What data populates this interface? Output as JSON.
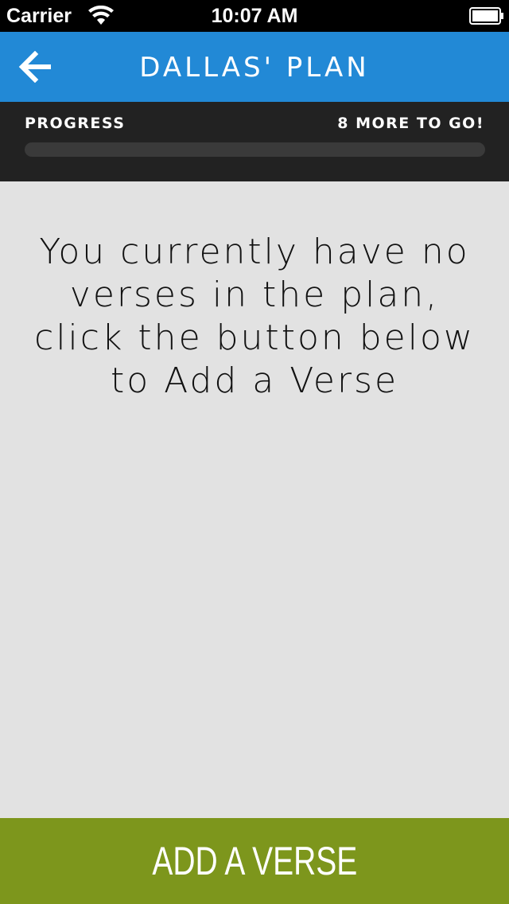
{
  "status_bar": {
    "carrier": "Carrier",
    "time": "10:07 AM",
    "wifi_icon": "wifi-icon",
    "battery_icon": "battery-icon"
  },
  "header": {
    "back_icon": "arrow-left-icon",
    "title": "DALLAS' PLAN"
  },
  "progress": {
    "label": "PROGRESS",
    "remaining_text": "8 MORE TO GO!",
    "fraction": 0
  },
  "main": {
    "empty_message": "You currently have no verses in the plan, click the button below to Add a Verse"
  },
  "footer": {
    "add_button_label": "ADD A VERSE"
  },
  "colors": {
    "header_bg": "#2289d6",
    "progress_panel_bg": "#222222",
    "content_bg": "#e2e2e2",
    "button_bg": "#7d961c"
  }
}
